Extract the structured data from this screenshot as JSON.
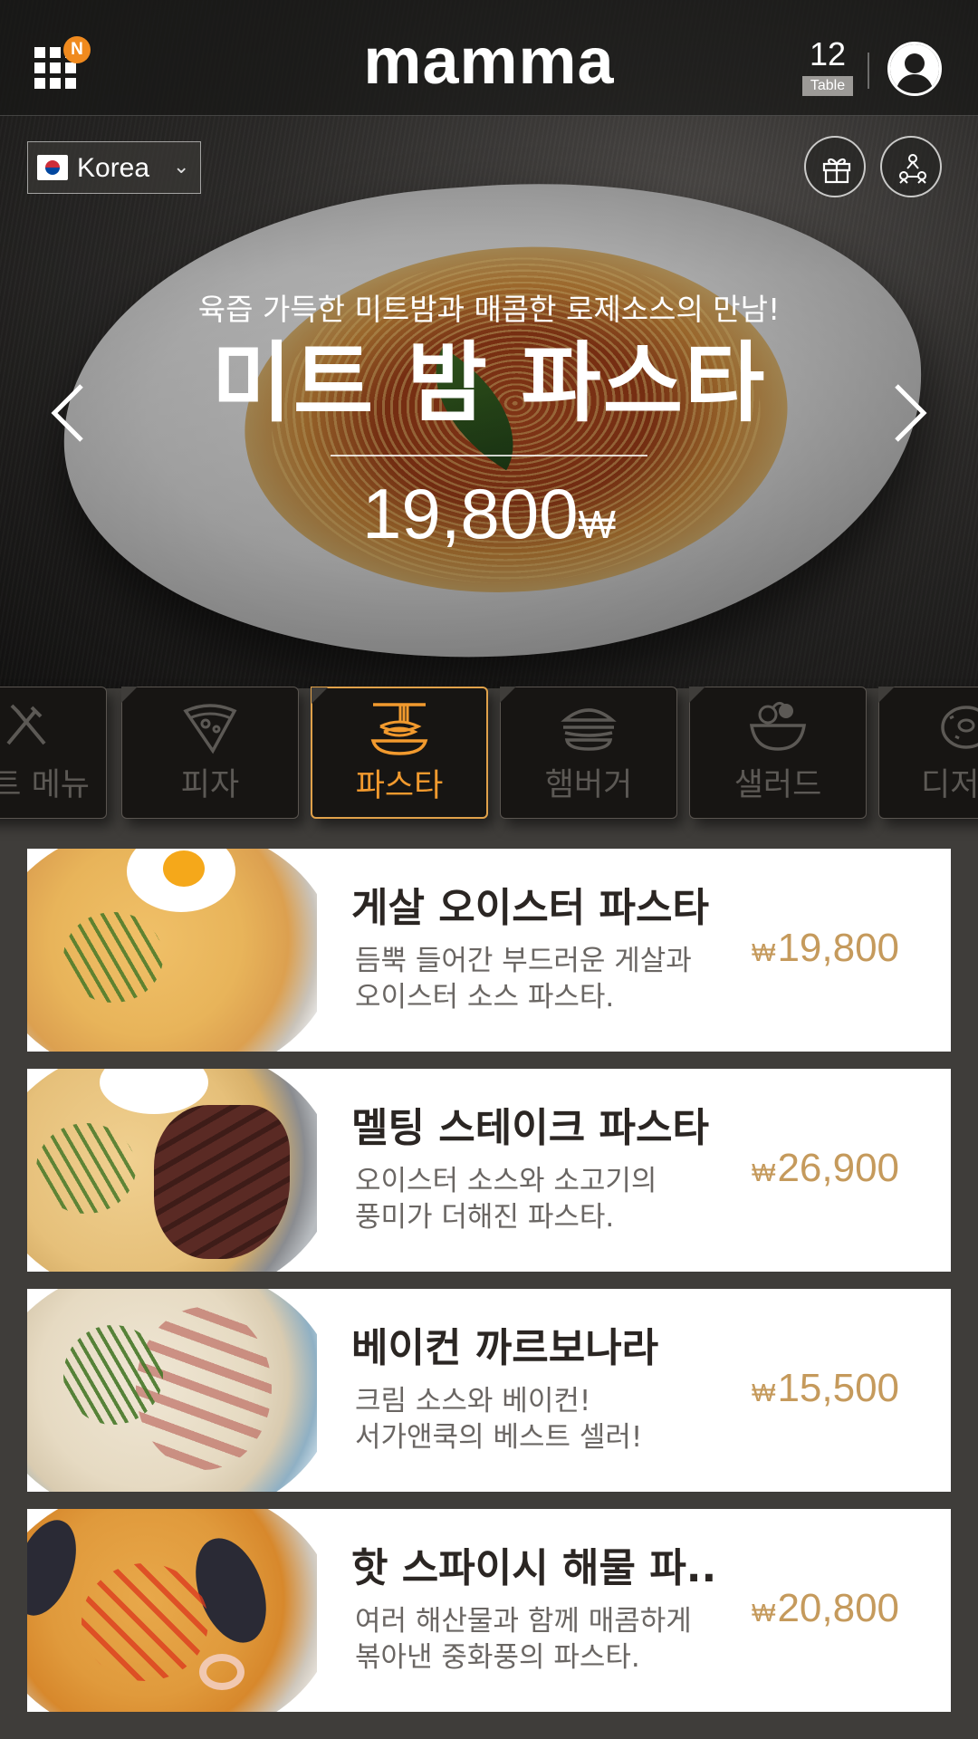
{
  "topbar": {
    "brand": "mamma",
    "notification_badge": "N",
    "table_number": "12",
    "table_label": "Table"
  },
  "country_select": {
    "selected": "Korea"
  },
  "hero": {
    "subtitle": "육즙 가득한 미트밤과 매콤한 로제소스의 만남!",
    "title": "미트 밤 파스타",
    "price": "19,800",
    "currency": "₩"
  },
  "categories": [
    {
      "label": "트 메뉴",
      "icon": "fork-knife-icon",
      "active": false
    },
    {
      "label": "피자",
      "icon": "pizza-icon",
      "active": false
    },
    {
      "label": "파스타",
      "icon": "pasta-icon",
      "active": true
    },
    {
      "label": "햄버거",
      "icon": "burger-icon",
      "active": false
    },
    {
      "label": "샐러드",
      "icon": "salad-icon",
      "active": false
    },
    {
      "label": "디저",
      "icon": "donut-icon",
      "active": false
    }
  ],
  "menu": [
    {
      "name": "게살 오이스터 파스타",
      "desc_line1": "듬뿍 들어간 부드러운 게살과",
      "desc_line2": "오이스터 소스 파스타.",
      "currency": "₩",
      "price": "19,800"
    },
    {
      "name": "멜팅 스테이크 파스타",
      "desc_line1": "오이스터 소스와 소고기의",
      "desc_line2": "풍미가 더해진 파스타.",
      "currency": "₩",
      "price": "26,900"
    },
    {
      "name": "베이컨 까르보나라",
      "desc_line1": "크림 소스와 베이컨!",
      "desc_line2": "서가앤쿡의 베스트 셀러!",
      "currency": "₩",
      "price": "15,500"
    },
    {
      "name": "핫 스파이시 해물 파..",
      "desc_line1": "여러 해산물과 함께 매콤하게",
      "desc_line2": "볶아낸 중화풍의 파스타.",
      "currency": "₩",
      "price": "20,800"
    }
  ],
  "colors": {
    "accent": "#f29a2e",
    "price": "#c59a5c",
    "badge": "#f08a1e"
  }
}
